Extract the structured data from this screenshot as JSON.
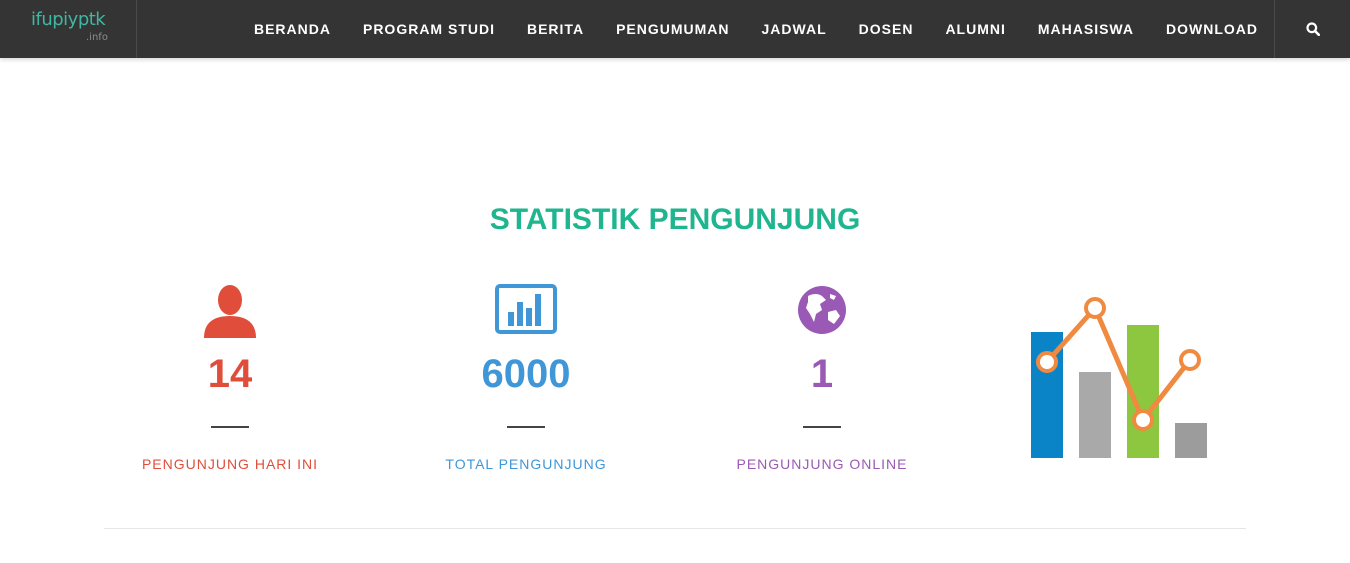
{
  "logo": {
    "main": "ifupiyptk",
    "sub": ".info"
  },
  "nav": {
    "items": [
      "BERANDA",
      "PROGRAM STUDI",
      "BERITA",
      "PENGUMUMAN",
      "JADWAL",
      "DOSEN",
      "ALUMNI",
      "MAHASISWA",
      "DOWNLOAD"
    ],
    "search_icon": "search-icon"
  },
  "section": {
    "title": "STATISTIK PENGUNJUNG"
  },
  "stats": [
    {
      "icon": "user-icon",
      "value": "14",
      "label": "PENGUNJUNG HARI INI",
      "color": "#e04e3b"
    },
    {
      "icon": "bar-chart-icon",
      "value": "6000",
      "label": "TOTAL PENGUNJUNG",
      "color": "#3f97d8"
    },
    {
      "icon": "globe-icon",
      "value": "1",
      "label": "PENGUNJUNG ONLINE",
      "color": "#9b59b6"
    }
  ],
  "decor": {
    "icon": "chart-illustration-icon"
  },
  "colors": {
    "navbar": "#343434",
    "title": "#1fb58f",
    "logo": "#3fb7a4"
  }
}
